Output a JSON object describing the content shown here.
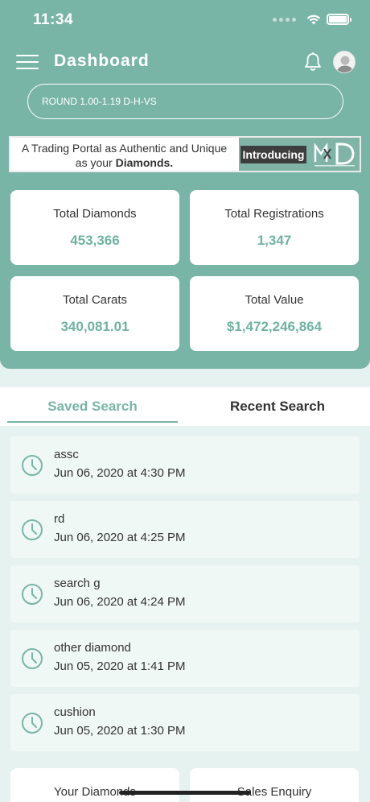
{
  "status_bar": {
    "time": "11:34"
  },
  "header": {
    "title": "Dashboard"
  },
  "filter": {
    "label": "ROUND 1.00-1.19 D-H-VS"
  },
  "banner": {
    "line1": "A Trading Portal as Authentic and Unique",
    "line2_prefix": "as your ",
    "line2_bold": "Diamonds.",
    "introducing": "Introducing",
    "logo_text": "MD"
  },
  "stats": {
    "total_diamonds": {
      "label": "Total Diamonds",
      "value": "453,366"
    },
    "total_registrations": {
      "label": "Total Registrations",
      "value": "1,347"
    },
    "total_carats": {
      "label": "Total Carats",
      "value": "340,081.01"
    },
    "total_value": {
      "label": "Total Value",
      "value": "$1,472,246,864"
    }
  },
  "tabs": {
    "saved": "Saved Search",
    "recent": "Recent Search"
  },
  "saved_searches": [
    {
      "name": "assc",
      "date": "Jun 06, 2020 at 4:30 PM"
    },
    {
      "name": "rd",
      "date": "Jun 06, 2020 at 4:25 PM"
    },
    {
      "name": "search g",
      "date": "Jun 06, 2020 at 4:24 PM"
    },
    {
      "name": "other diamond",
      "date": "Jun 05, 2020 at 1:41 PM"
    },
    {
      "name": "cushion",
      "date": "Jun 05, 2020 at 1:30 PM"
    }
  ],
  "bottom_cards": {
    "your_diamonds": "Your Diamonds",
    "sales_enquiry": "Sales Enquiry"
  },
  "colors": {
    "primary": "#79b5a7",
    "value_text": "#6fb2a2",
    "background": "#e6f2ef"
  },
  "icons": {
    "menu": "hamburger-icon",
    "notifications": "bell-icon",
    "profile": "avatar",
    "history": "clock-icon"
  }
}
